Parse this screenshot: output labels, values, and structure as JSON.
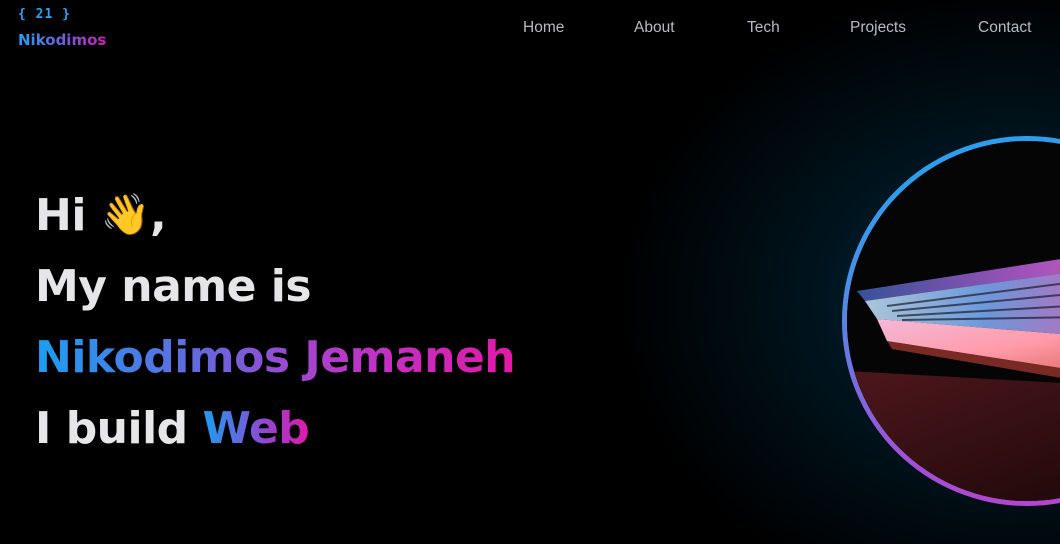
{
  "logo": {
    "badge": "{ 21 }",
    "name": "Nikodimos"
  },
  "nav": {
    "items": [
      "Home",
      "About",
      "Tech",
      "Projects",
      "Contact"
    ]
  },
  "hero": {
    "greeting": "Hi",
    "wave_emoji": "👋",
    "comma": ",",
    "line2": "My name is",
    "name": "Nikodimos Jemaneh",
    "line4_prefix": "I build",
    "line4_highlight": "Web"
  },
  "colors": {
    "background": "#000000",
    "accent_blue": "#1a9ff1",
    "accent_pink": "#e318a8",
    "text": "#e6e6e8",
    "nav_text": "#b8bcc2"
  },
  "icons": {
    "wave": "waving-hand-icon",
    "photo": "laptop-photo"
  }
}
